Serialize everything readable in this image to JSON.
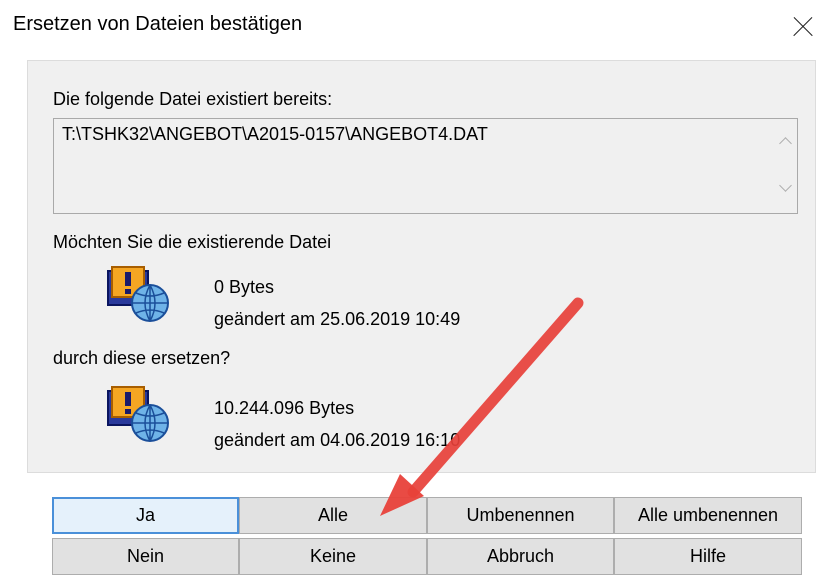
{
  "dialog": {
    "title": "Ersetzen von Dateien bestätigen"
  },
  "content": {
    "exists_label": "Die folgende Datei existiert bereits:",
    "path": "T:\\TSHK32\\ANGEBOT\\A2015-0157\\ANGEBOT4.DAT",
    "question_label": "Möchten Sie die existierende Datei",
    "existing_file": {
      "size": "0 Bytes",
      "modified": "geändert am 25.06.2019 10:49"
    },
    "replace_label": "durch diese ersetzen?",
    "new_file": {
      "size": "10.244.096 Bytes",
      "modified": "geändert am 04.06.2019 16:10"
    }
  },
  "buttons": {
    "yes": "Ja",
    "all": "Alle",
    "rename": "Umbenennen",
    "rename_all": "Alle umbenennen",
    "no": "Nein",
    "none": "Keine",
    "cancel": "Abbruch",
    "help": "Hilfe"
  },
  "colors": {
    "annotation_arrow": "#e8413a",
    "default_button_border": "#4a90d9"
  },
  "icons": {
    "close": "close-icon",
    "file": "file-warning-globe-icon",
    "scroll_up": "chevron-up-icon",
    "scroll_down": "chevron-down-icon"
  }
}
